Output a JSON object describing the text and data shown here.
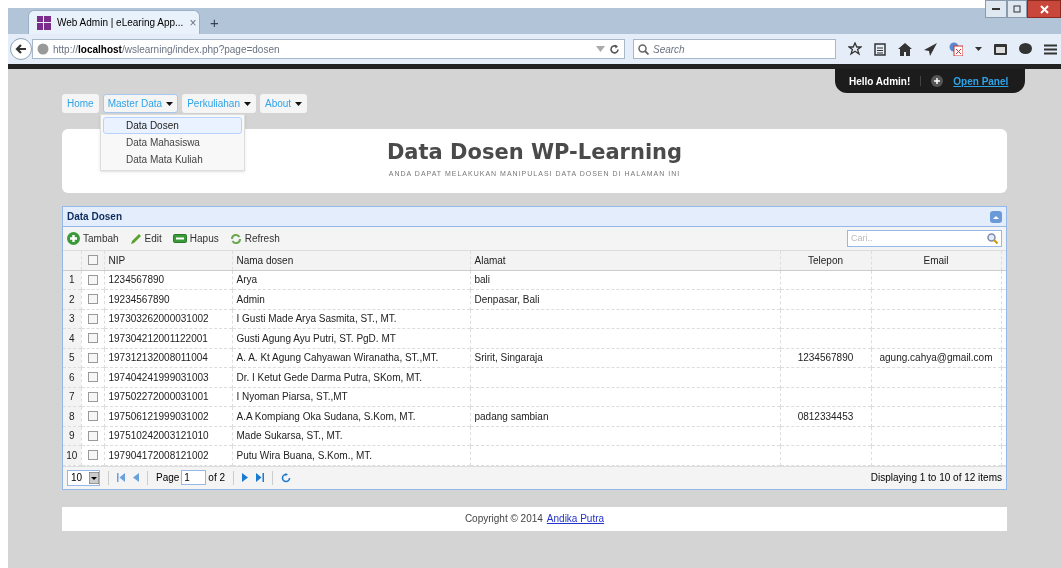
{
  "browser": {
    "tab_title": "Web Admin | eLearing App...",
    "tab_close": "×",
    "new_tab": "+",
    "url_host": "localhost",
    "url_scheme": "http://",
    "url_path": "/wslearning/index.php?page=dosen",
    "search_placeholder": "Search"
  },
  "user_panel": {
    "greeting": "Hello Admin!",
    "link": "Open Panel"
  },
  "menu": [
    {
      "label": "Home",
      "dropdown": false,
      "selected": false
    },
    {
      "label": "Master Data",
      "dropdown": true,
      "selected": true
    },
    {
      "label": "Perkuliahan",
      "dropdown": true,
      "selected": false
    },
    {
      "label": "About",
      "dropdown": true,
      "selected": false
    }
  ],
  "dropdown_items": [
    {
      "label": "Data Dosen",
      "selected": true
    },
    {
      "label": "Data Mahasiswa",
      "selected": false
    },
    {
      "label": "Data Mata Kuliah",
      "selected": false
    }
  ],
  "header": {
    "title": "Data Dosen WP-Learning",
    "subtitle": "ANDA DAPAT MELAKUKAN MANIPULASI DATA DOSEN DI HALAMAN INI"
  },
  "grid": {
    "title": "Data Dosen",
    "toolbar": [
      {
        "kind": "add",
        "label": "Tambah"
      },
      {
        "kind": "edit",
        "label": "Edit"
      },
      {
        "kind": "delete",
        "label": "Hapus"
      },
      {
        "kind": "refresh",
        "label": "Refresh"
      }
    ],
    "search_placeholder": "Cari..",
    "select_all_checked": false,
    "columns": [
      "NIP",
      "Nama dosen",
      "Alamat",
      "Telepon",
      "Email"
    ],
    "rows": [
      {
        "no": "1",
        "checked": false,
        "cells": [
          "1234567890",
          "Arya",
          "bali",
          "",
          ""
        ]
      },
      {
        "no": "2",
        "checked": false,
        "cells": [
          "19234567890",
          "Admin",
          "Denpasar, Bali",
          "",
          ""
        ]
      },
      {
        "no": "3",
        "checked": false,
        "cells": [
          "197303262000031002",
          "I Gusti Made Arya Sasmita, ST., MT.",
          "",
          "",
          ""
        ]
      },
      {
        "no": "4",
        "checked": false,
        "cells": [
          "197304212001122001",
          "Gusti Agung Ayu Putri, ST. PgD. MT",
          "",
          "",
          ""
        ]
      },
      {
        "no": "5",
        "checked": false,
        "cells": [
          "197312132008011004",
          "A. A. Kt Agung Cahyawan Wiranatha, ST.,MT.",
          "Sririt, Singaraja",
          "1234567890",
          "agung.cahya@gmail.com"
        ]
      },
      {
        "no": "6",
        "checked": false,
        "cells": [
          "197404241999031003",
          "Dr. I Ketut Gede Darma Putra, SKom, MT.",
          "",
          "",
          ""
        ]
      },
      {
        "no": "7",
        "checked": false,
        "cells": [
          "197502272000031001",
          "I Nyoman Piarsa, ST.,MT",
          "",
          "",
          ""
        ]
      },
      {
        "no": "8",
        "checked": false,
        "cells": [
          "197506121999031002",
          "A.A Kompiang Oka Sudana, S.Kom, MT.",
          "padang sambian",
          "0812334453",
          ""
        ]
      },
      {
        "no": "9",
        "checked": false,
        "cells": [
          "197510242003121010",
          "Made Sukarsa, ST., MT.",
          "",
          "",
          ""
        ]
      },
      {
        "no": "10",
        "checked": false,
        "cells": [
          "197904172008121002",
          "Putu Wira Buana, S.Kom., MT.",
          "",
          "",
          ""
        ]
      }
    ],
    "pager": {
      "page_size": "10",
      "page_label": "Page",
      "page": "1",
      "of": "of 2",
      "info": "Displaying 1 to 10 of 12 items"
    }
  },
  "footer": {
    "text": "Copyright © 2014",
    "link": "Andika Putra"
  }
}
